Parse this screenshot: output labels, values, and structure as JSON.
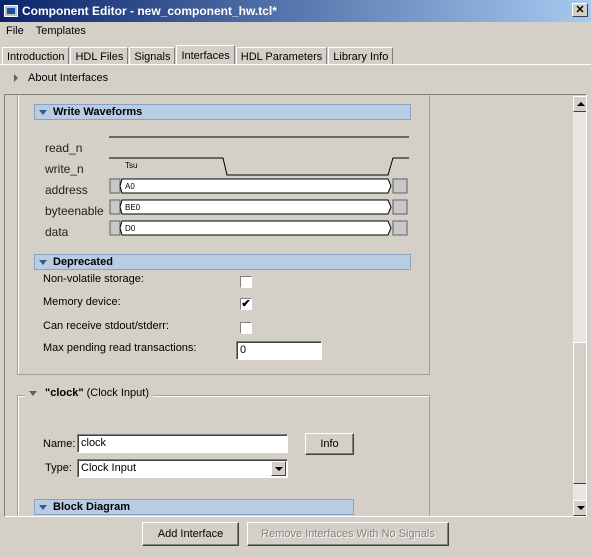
{
  "window": {
    "title": "Component Editor - new_component_hw.tcl*"
  },
  "menu": [
    "File",
    "Templates"
  ],
  "tabs": [
    "Introduction",
    "HDL Files",
    "Signals",
    "Interfaces",
    "HDL Parameters",
    "Library Info"
  ],
  "active_tab": "Interfaces",
  "about_interfaces": "About Interfaces",
  "write_waveforms": {
    "title": "Write Waveforms",
    "signals": [
      "read_n",
      "write_n",
      "address",
      "byteenable",
      "data"
    ],
    "write_label": "Tsu",
    "address_value": "A0",
    "byteenable_value": "BE0",
    "data_value": "D0"
  },
  "deprecated": {
    "title": "Deprecated",
    "non_volatile_label": "Non-volatile storage:",
    "non_volatile_checked": false,
    "memory_device_label": "Memory device:",
    "memory_device_checked": true,
    "memory_device_mark": "✔",
    "stdout_label": "Can receive stdout/stderr:",
    "stdout_checked": false,
    "max_pending_label": "Max pending read transactions:",
    "max_pending_value": "0"
  },
  "clock_interface": {
    "header_name": "\"clock\"",
    "header_type": "(Clock Input)",
    "name_label": "Name:",
    "name_value": "clock",
    "info_button": "Info",
    "type_label": "Type:",
    "type_value": "Clock Input"
  },
  "block_diagram": {
    "title": "Block Diagram"
  },
  "footer": {
    "add_button": "Add Interface",
    "remove_button": "Remove Interfaces With No Signals"
  },
  "icons": {
    "close": "close-icon",
    "expand": "triangle-icon"
  }
}
